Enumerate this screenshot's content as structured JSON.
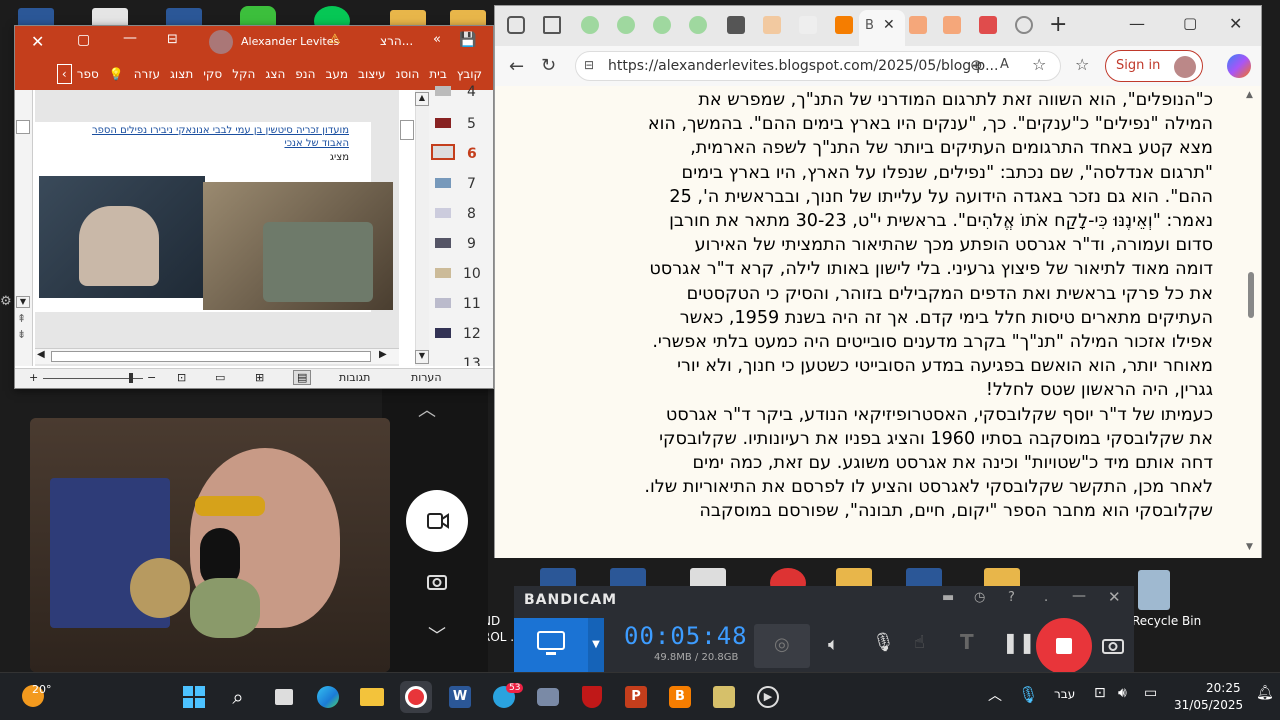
{
  "ppt": {
    "title": "הרצ...",
    "user": "Alexander Levites",
    "ribbon_tabs": [
      "קובץ",
      "בית",
      "הוסנ",
      "עיצוב",
      "מעב",
      "הנפ",
      "הצג",
      "הקל",
      "סקי",
      "תצוג",
      "עזרה",
      "ספר"
    ],
    "slide_numbers": [
      "4",
      "5",
      "6",
      "7",
      "8",
      "9",
      "10",
      "11",
      "12",
      "13"
    ],
    "active_slide": "6",
    "slide_link_text": "מועדון זכריה סיטשין בן עמי לבבי אנונאקי ניבירו נפילים הספר האבוד של אנכי",
    "slide_sub": "מציג",
    "status_notes": "הערות",
    "status_comments": "תגובות"
  },
  "browser": {
    "url": "https://alexanderlevites.blogspot.com/2025/05/blog-p...",
    "sign_in": "Sign in",
    "article_lines": [
      "כ\"הנופלים\", הוא השווה זאת לתרגום המודרני של התנ\"ך, שמפרש את",
      "המילה \"נפילים\" כ\"ענקים\". כך, \"ענקים היו בארץ בימים ההם\". בהמשך, הוא",
      "מצא קטע באחד התרגומים העתיקים ביותר של התנ\"ך לשפה הארמית,",
      "\"תרגום אנדלסה\", שם נכתב: \"נפילים, שנפלו על הארץ, היו בארץ בימים",
      "ההם\". הוא גם נזכר באגדה הידועה על עלייתו של חנוך, ובבראשית ה', 25",
      "נאמר: \"וְאֵינֶנּוּ כִּי-לָקַח אֹתוֹ אֱלֹהִים\". בראשית י\"ט, 30-23 מתאר את חורבן",
      "סדום ועמורה, וד\"ר אגרסט הופתע מכך שהתיאור התמציתי של האירוע",
      "דומה מאוד לתיאור של פיצוץ גרעיני. בלי לישון באותו לילה, קרא ד\"ר אגרסט",
      "את כל פרקי בראשית ואת הדפים המקבילים בזוהר, והסיק כי הטקסטים",
      "העתיקים מתארים טיסות חלל בימי קדם. אך זה היה בשנת 1959, כאשר",
      "אפילו אזכור המילה \"תנ\"ך\" בקרב מדענים סובייטים היה כמעט בלתי אפשרי.",
      "מאוחר יותר, הוא הואשם בפגיעה במדע הסובייטי כשטען כי חנוך, ולא יורי",
      "גגרין, היה הראשון שטס לחלל!",
      "כעמיתו של ד\"ר יוסף שקלובסקי, האסטרופיזיקאי הנודע, ביקר ד\"ר אגרסט",
      "את שקלובסקי במוסקבה בסתיו 1960 והציג בפניו את רעיונותיו. שקלובסקי",
      "דחה אותם מיד כ\"שטויות\" וכינה את אגרסט משוגע. עם זאת, כמה ימים",
      "לאחר מכן, התקשר שקלובסקי לאגרסט והציע לו לפרסם את התיאוריות שלו.",
      "שקלובסקי הוא מחבר הספר \"יקום, חיים, תבונה\", שפורסם במוסקבה"
    ]
  },
  "bandicam": {
    "brand": "BANDICAM",
    "timer": "00:05:48",
    "size": "49.8MB / 20.8GB"
  },
  "desktop_labels": {
    "recycle": "Recycle Bin",
    "left1": "ND",
    "left2": "ROL ..."
  },
  "taskbar": {
    "weather": "20°",
    "lang": "עבר",
    "time": "20:25",
    "date": "31/05/2025",
    "telegram_badge": "53"
  }
}
